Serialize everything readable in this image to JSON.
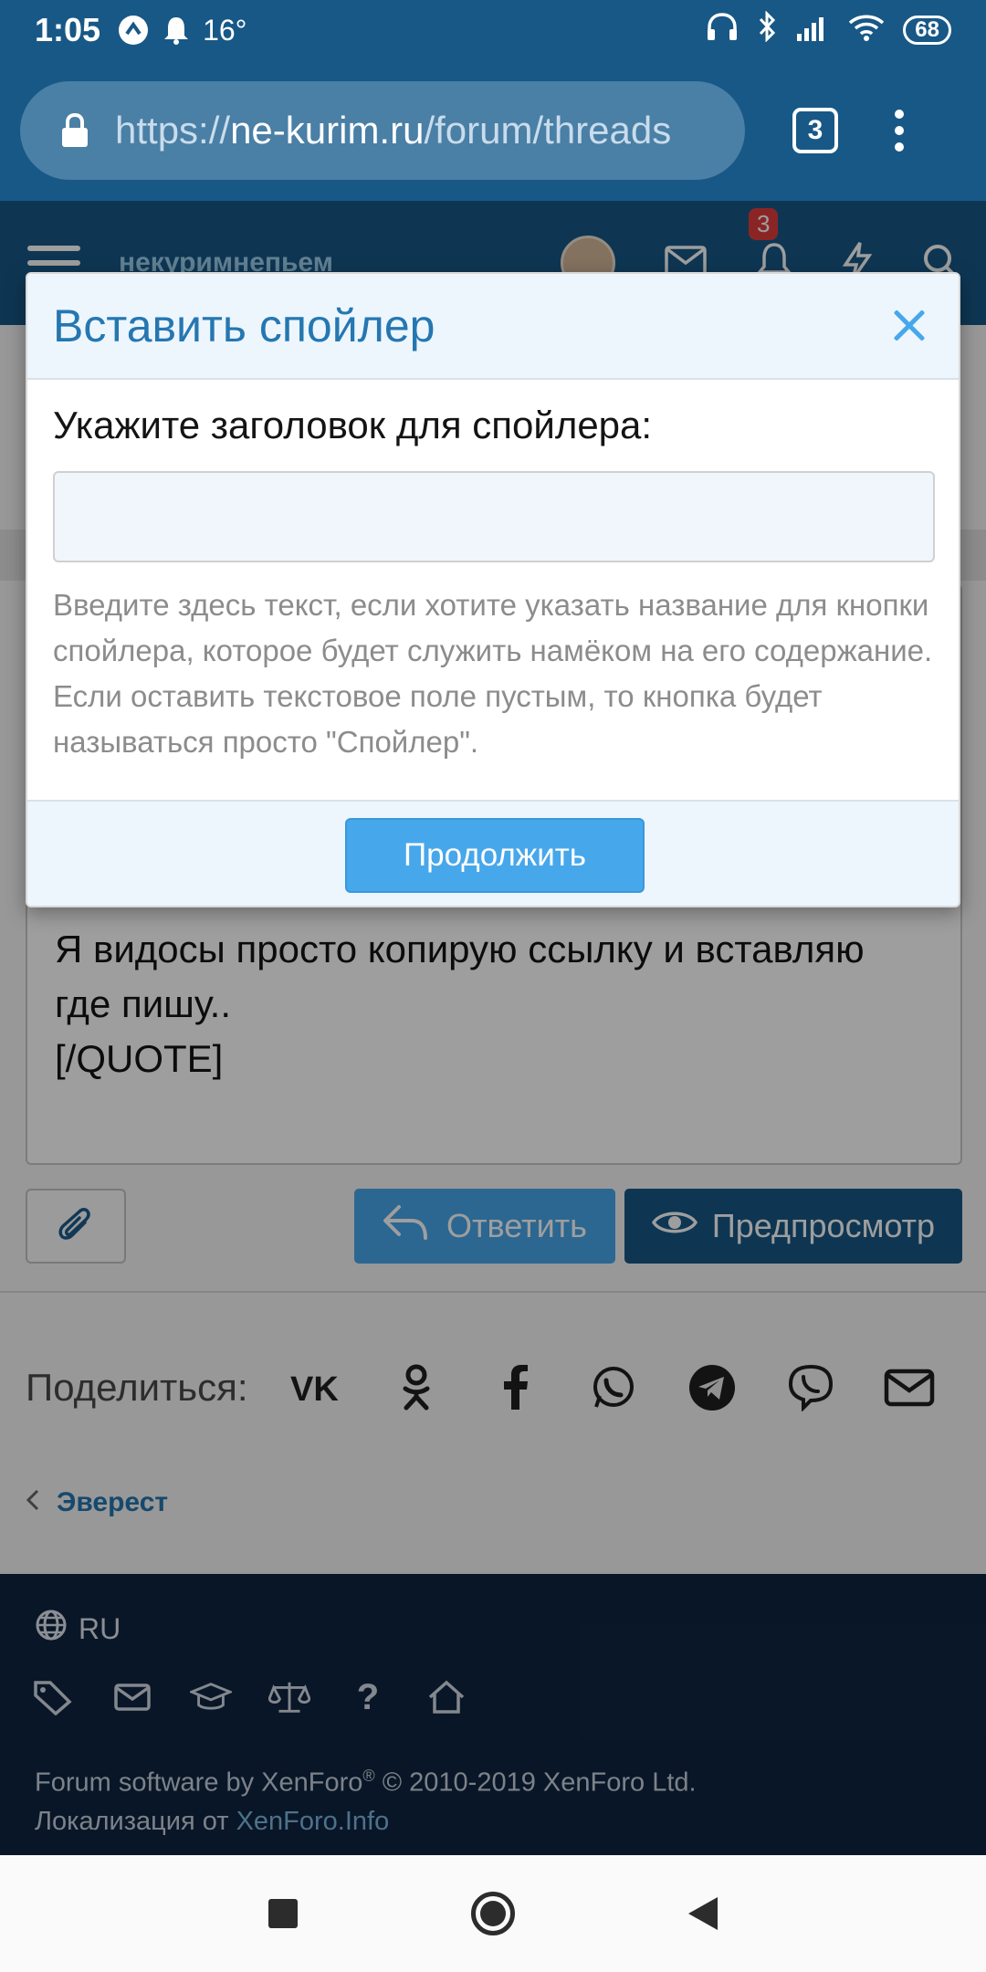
{
  "status_bar": {
    "time": "1:05",
    "temperature": "16°",
    "battery": "68"
  },
  "browser": {
    "url_prefix": "https://",
    "url_domain": "ne-kurim.ru",
    "url_path": "/forum/threads",
    "tab_count": "3"
  },
  "forum_header": {
    "logo_text": "некуримнепьем",
    "notification_count": "3"
  },
  "editor": {
    "lines": [
      "Я видосы просто копирую ссылку и вставляю",
      "где пишу..",
      "[/QUOTE]"
    ]
  },
  "actions": {
    "reply_label": "Ответить",
    "preview_label": "Предпросмотр"
  },
  "share": {
    "label": "Поделиться:",
    "icons": [
      "vk-icon",
      "odnoklassniki-icon",
      "facebook-icon",
      "whatsapp-icon",
      "telegram-icon",
      "viber-icon",
      "email-icon"
    ]
  },
  "breadcrumb": {
    "link": "Эверест"
  },
  "footer": {
    "language": "RU",
    "copyright_line1_a": "Forum software by XenForo",
    "copyright_reg": "®",
    "copyright_line1_b": " © 2010-2019 XenForo Ltd.",
    "localization_prefix": "Локализация от ",
    "localization_link": "XenForo.Info"
  },
  "modal": {
    "title": "Вставить спойлер",
    "label": "Укажите заголовок для спойлера:",
    "input_value": "",
    "hint": "Введите здесь текст, если хотите указать название для кнопки спойлера, которое будет служить намёком на его содержание. Если оставить текстовое поле пустым, то кнопка будет называться просто \"Спойлер\".",
    "continue_label": "Продолжить"
  },
  "colors": {
    "brand_blue": "#185886",
    "accent_blue": "#47a7eb",
    "link_blue": "#2577b1",
    "footer_bg": "#0f2540"
  }
}
